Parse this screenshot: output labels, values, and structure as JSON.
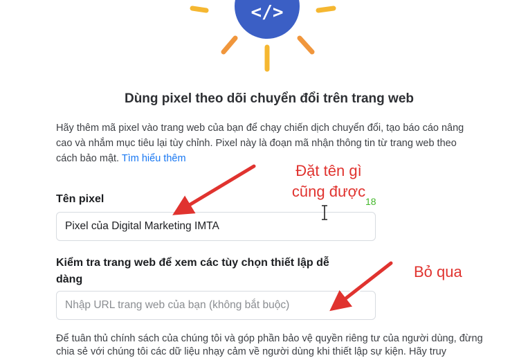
{
  "illustration": {
    "icon": "code-icon",
    "icon_glyph": "</>",
    "circle_color": "#3b5fc5",
    "ray_color": "#f5b731",
    "accent_ray_color": "#f0963c"
  },
  "title": "Dùng pixel theo dõi chuyển đổi trên trang web",
  "intro": {
    "text": "Hãy thêm mã pixel vào trang web của bạn để chạy chiến dịch chuyển đổi, tạo báo cáo nâng cao và nhắm mục tiêu lại tùy chỉnh. Pixel này là đoạn mã nhận thông tin từ trang web theo cách bảo mật.",
    "link": "Tìm hiểu thêm"
  },
  "pixel_name": {
    "label": "Tên pixel",
    "value": "Pixel của Digital Marketing IMTA",
    "counter": "18"
  },
  "website_check": {
    "label": "Kiểm tra trang web để xem các tùy chọn thiết lập dễ dàng",
    "placeholder": "Nhập URL trang web của bạn (không bắt buộc)"
  },
  "privacy_text": "Để tuân thủ chính sách của chúng tôi và góp phần bảo vệ quyền riêng tư của người dùng, đừng chia sẻ với chúng tôi các dữ liệu nhạy cảm về người dùng khi thiết lập sự kiện. Hãy truy",
  "annotations": {
    "name_note": "Đặt tên gì cũng được",
    "skip_note": "Bỏ qua",
    "color": "#e0332f"
  }
}
